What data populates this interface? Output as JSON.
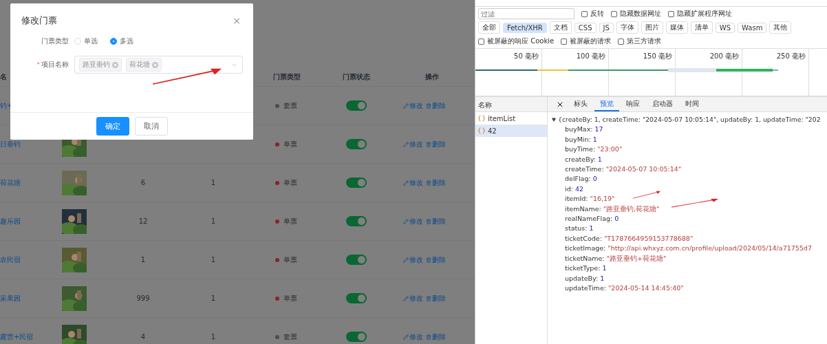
{
  "dialog": {
    "title": "修改门票",
    "close": "×",
    "fields": [
      {
        "kind": "radio",
        "label": "门票类型",
        "options": [
          {
            "label": "单选",
            "selected": false
          },
          {
            "label": "多选",
            "selected": true
          }
        ]
      },
      {
        "kind": "tags",
        "label": "项目名称",
        "required_mark": "*",
        "tags": [
          "路亚垂钓",
          "荷花塘"
        ]
      }
    ],
    "buttons": [
      {
        "label": "确定",
        "primary": true
      },
      {
        "label": "取消",
        "primary": false
      }
    ]
  },
  "table": {
    "columns": [
      {
        "kind": "name",
        "label": "名"
      },
      {
        "kind": "type",
        "label": "门票类型"
      },
      {
        "kind": "status",
        "label": "门票状态"
      },
      {
        "kind": "actions",
        "label": "操作"
      }
    ],
    "rows": [
      {
        "name": "钓+",
        "type": "套票",
        "color": "#4d4d4d",
        "on": true,
        "actions": [
          "修改",
          "删除"
        ]
      },
      {
        "name": "日垂钓",
        "image": {
          "kind": "picture"
        },
        "type": "单票",
        "color": "#8a2323",
        "on": true,
        "actions": [
          "修改",
          "删除"
        ]
      },
      {
        "name": "荷花塘",
        "image": {
          "kind": "picture"
        },
        "count": "6",
        "limit": "1",
        "type": "单票",
        "color": "#8a2323",
        "on": true,
        "actions": [
          "修改",
          "删除"
        ]
      },
      {
        "name": "趣乐园",
        "image": {
          "kind": "picture"
        },
        "count": "12",
        "limit": "1",
        "type": "单票",
        "color": "#8a2323",
        "on": true,
        "actions": [
          "修改",
          "删除"
        ]
      },
      {
        "name": "农民宿",
        "image": {
          "kind": "picture"
        },
        "count": "1",
        "limit": "1",
        "type": "单票",
        "color": "#8a2323",
        "on": true,
        "actions": [
          "修改",
          "删除"
        ]
      },
      {
        "name": "采果园",
        "image": {
          "kind": "picture"
        },
        "count": "999",
        "limit": "1",
        "type": "单票",
        "color": "#8a2323",
        "on": true,
        "actions": [
          "修改",
          "删除"
        ]
      },
      {
        "name": "露营+民宿",
        "image": {
          "kind": "picture"
        },
        "count": "4",
        "limit": "1",
        "type": "套票",
        "color": "#4d4d4d",
        "on": true,
        "actions": [
          "修改",
          "删除"
        ]
      }
    ]
  },
  "devtools": {
    "filter": {
      "placeholder": "过滤"
    },
    "filter_options": [
      {
        "label": "反转",
        "checked": false
      },
      {
        "label": "隐藏数据网址",
        "checked": false
      },
      {
        "label": "隐藏扩展程序网址",
        "checked": false
      }
    ],
    "type_filters": [
      {
        "label": "全部",
        "selected": false
      },
      {
        "label": "Fetch/XHR",
        "selected": true
      },
      {
        "label": "文档",
        "selected": false
      },
      {
        "label": "CSS",
        "selected": false
      },
      {
        "label": "JS",
        "selected": false
      },
      {
        "label": "字体",
        "selected": false
      },
      {
        "label": "图片",
        "selected": false
      },
      {
        "label": "媒体",
        "selected": false
      },
      {
        "label": "清单",
        "selected": false
      },
      {
        "label": "WS",
        "selected": false
      },
      {
        "label": "Wasm",
        "selected": false
      },
      {
        "label": "其他",
        "selected": false
      }
    ],
    "blocked_options": [
      {
        "label": "被屏蔽的响应 Cookie",
        "checked": false
      },
      {
        "label": "被屏蔽的请求",
        "checked": false
      },
      {
        "label": "第三方请求",
        "checked": false
      }
    ],
    "timeline": {
      "ticks": [
        "50 毫秒",
        "100 毫秒",
        "150 毫秒",
        "200 毫秒",
        "250 毫秒"
      ]
    },
    "requests": {
      "header": "名称",
      "items": [
        {
          "name": "itemList",
          "selected": false
        },
        {
          "name": "42",
          "selected": true
        }
      ]
    },
    "detail_tabs": [
      {
        "label": "标头",
        "selected": false
      },
      {
        "label": "预览",
        "selected": true
      },
      {
        "label": "响应",
        "selected": false
      },
      {
        "label": "启动器",
        "selected": false
      },
      {
        "label": "时间",
        "selected": false
      }
    ],
    "preview": {
      "summary": "{createBy: 1, createTime: \"2024-05-07 10:05:14\", updateBy: 1, updateTime: \"202",
      "properties": [
        {
          "key": "buyMax:",
          "value": "17",
          "kind": "number"
        },
        {
          "key": "buyMin:",
          "value": "1",
          "kind": "number"
        },
        {
          "key": "buyTime:",
          "value": "\"23:00\"",
          "kind": "string"
        },
        {
          "key": "createBy:",
          "value": "1",
          "kind": "number"
        },
        {
          "key": "createTime:",
          "value": "\"2024-05-07 10:05:14\"",
          "kind": "string"
        },
        {
          "key": "delFlag:",
          "value": "0",
          "kind": "number"
        },
        {
          "key": "id:",
          "value": "42",
          "kind": "number"
        },
        {
          "key": "itemId:",
          "value": "\"16,19\"",
          "kind": "string"
        },
        {
          "key": "itemName:",
          "value": "\"路亚垂钓,荷花塘\"",
          "kind": "string"
        },
        {
          "key": "realNameFlag:",
          "value": "0",
          "kind": "number"
        },
        {
          "key": "status:",
          "value": "1",
          "kind": "number"
        },
        {
          "key": "ticketCode:",
          "value": "\"T1787664959153778688\"",
          "kind": "string"
        },
        {
          "key": "ticketImage:",
          "value": "\"http://api.whxyz.com.cn/profile/upload/2024/05/14/a71755d7",
          "kind": "string"
        },
        {
          "key": "ticketName:",
          "value": "\"路亚垂钓+荷花塘\"",
          "kind": "string"
        },
        {
          "key": "ticketType:",
          "value": "1",
          "kind": "number"
        },
        {
          "key": "updateBy:",
          "value": "1",
          "kind": "number"
        },
        {
          "key": "updateTime:",
          "value": "\"2024-05-14 14:45:40\"",
          "kind": "string"
        }
      ]
    }
  }
}
